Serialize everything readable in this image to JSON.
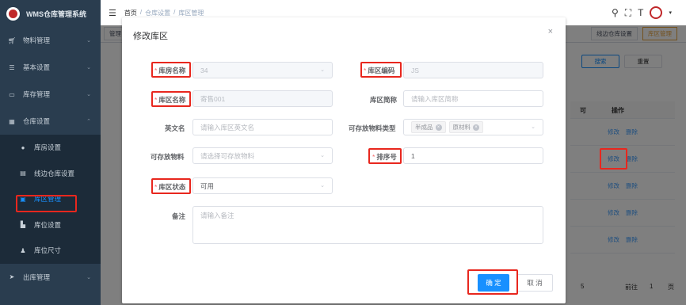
{
  "app": {
    "title": "WMS仓库管理系统"
  },
  "sidebar": {
    "items": [
      {
        "label": "物料管理",
        "icon": "cart-icon"
      },
      {
        "label": "基本设置",
        "icon": "sliders-icon"
      },
      {
        "label": "库存管理",
        "icon": "monitor-icon"
      },
      {
        "label": "仓库设置",
        "icon": "grid-icon"
      },
      {
        "label": "库房设置",
        "icon": "github-icon"
      },
      {
        "label": "线边仓库设置",
        "icon": "list-icon"
      },
      {
        "label": "库区管理",
        "icon": "region-icon"
      },
      {
        "label": "库位设置",
        "icon": "location-icon"
      },
      {
        "label": "库位尺寸",
        "icon": "ruler-icon"
      },
      {
        "label": "出库管理",
        "icon": "send-icon"
      }
    ]
  },
  "header": {
    "breadcrumb": [
      "首页",
      "仓库设置",
      "库区管理"
    ],
    "separator": "/"
  },
  "tags": {
    "left_partial": "管理",
    "right": [
      "线边仓库设置",
      "库区管理"
    ]
  },
  "background": {
    "search_label": "搜索",
    "reset_label": "重置",
    "col_partial": "可",
    "col_action": "操作",
    "edit_label": "修改",
    "delete_label": "删除",
    "pager_page": "5",
    "pager_goto": "前往",
    "pager_num": "1",
    "pager_unit": "页"
  },
  "dialog": {
    "title": "修改库区",
    "close": "×",
    "fields": {
      "warehouse_name": {
        "label": "库房名称",
        "value": "34"
      },
      "area_code": {
        "label": "库区编码",
        "value": "JS"
      },
      "area_name": {
        "label": "库区名称",
        "value": "寄售001"
      },
      "area_short": {
        "label": "库区简称",
        "placeholder": "请输入库区简称"
      },
      "english_name": {
        "label": "英文名",
        "placeholder": "请输入库区英文名"
      },
      "material_types": {
        "label": "可存放物料类型",
        "chips": [
          "半成品",
          "原材料"
        ]
      },
      "materials": {
        "label": "可存放物料",
        "placeholder": "请选择可存放物料"
      },
      "sort_no": {
        "label": "排序号",
        "value": "1"
      },
      "area_status": {
        "label": "库区状态",
        "value": "可用"
      },
      "remark": {
        "label": "备注",
        "placeholder": "请输入备注"
      }
    },
    "confirm_label": "确 定",
    "cancel_label": "取 消"
  },
  "colors": {
    "primary": "#1890ff",
    "highlight_box": "#e8271e",
    "sidebar": "#2a3d4f"
  }
}
